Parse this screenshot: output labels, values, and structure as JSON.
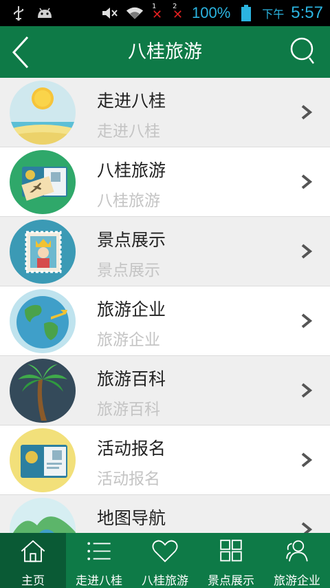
{
  "status_bar": {
    "sim1_num": "1",
    "sim2_num": "2",
    "battery_pct": "100%",
    "ampm": "下午",
    "time": "5:57",
    "icons": [
      "usb-icon",
      "android-icon",
      "mute-icon",
      "wifi-icon",
      "battery-icon"
    ]
  },
  "header": {
    "title": "八桂旅游"
  },
  "list": {
    "items": [
      {
        "title": "走进八桂",
        "subtitle": "走进八桂",
        "icon": "beach-sun-icon"
      },
      {
        "title": "八桂旅游",
        "subtitle": "八桂旅游",
        "icon": "passport-ticket-icon"
      },
      {
        "title": "景点展示",
        "subtitle": "景点展示",
        "icon": "stamp-king-icon"
      },
      {
        "title": "旅游企业",
        "subtitle": "旅游企业",
        "icon": "globe-plane-icon"
      },
      {
        "title": "旅游百科",
        "subtitle": "旅游百科",
        "icon": "palm-tree-icon"
      },
      {
        "title": "活动报名",
        "subtitle": "活动报名",
        "icon": "passport-icon"
      },
      {
        "title": "地图导航",
        "subtitle": "",
        "icon": "map-hills-icon"
      }
    ]
  },
  "bottom_nav": {
    "items": [
      {
        "label": "主页",
        "icon": "home-icon",
        "active": true
      },
      {
        "label": "走进八桂",
        "icon": "list-icon",
        "active": false
      },
      {
        "label": "八桂旅游",
        "icon": "heart-icon",
        "active": false
      },
      {
        "label": "景点展示",
        "icon": "grid-icon",
        "active": false
      },
      {
        "label": "旅游企业",
        "icon": "users-icon",
        "active": false
      }
    ]
  },
  "colors": {
    "header_bg": "#0e7a47",
    "nav_active_bg": "#0a5a35",
    "status_text": "#2bb4e0",
    "row_odd": "#efefef",
    "subtitle": "#c4c4c4"
  }
}
